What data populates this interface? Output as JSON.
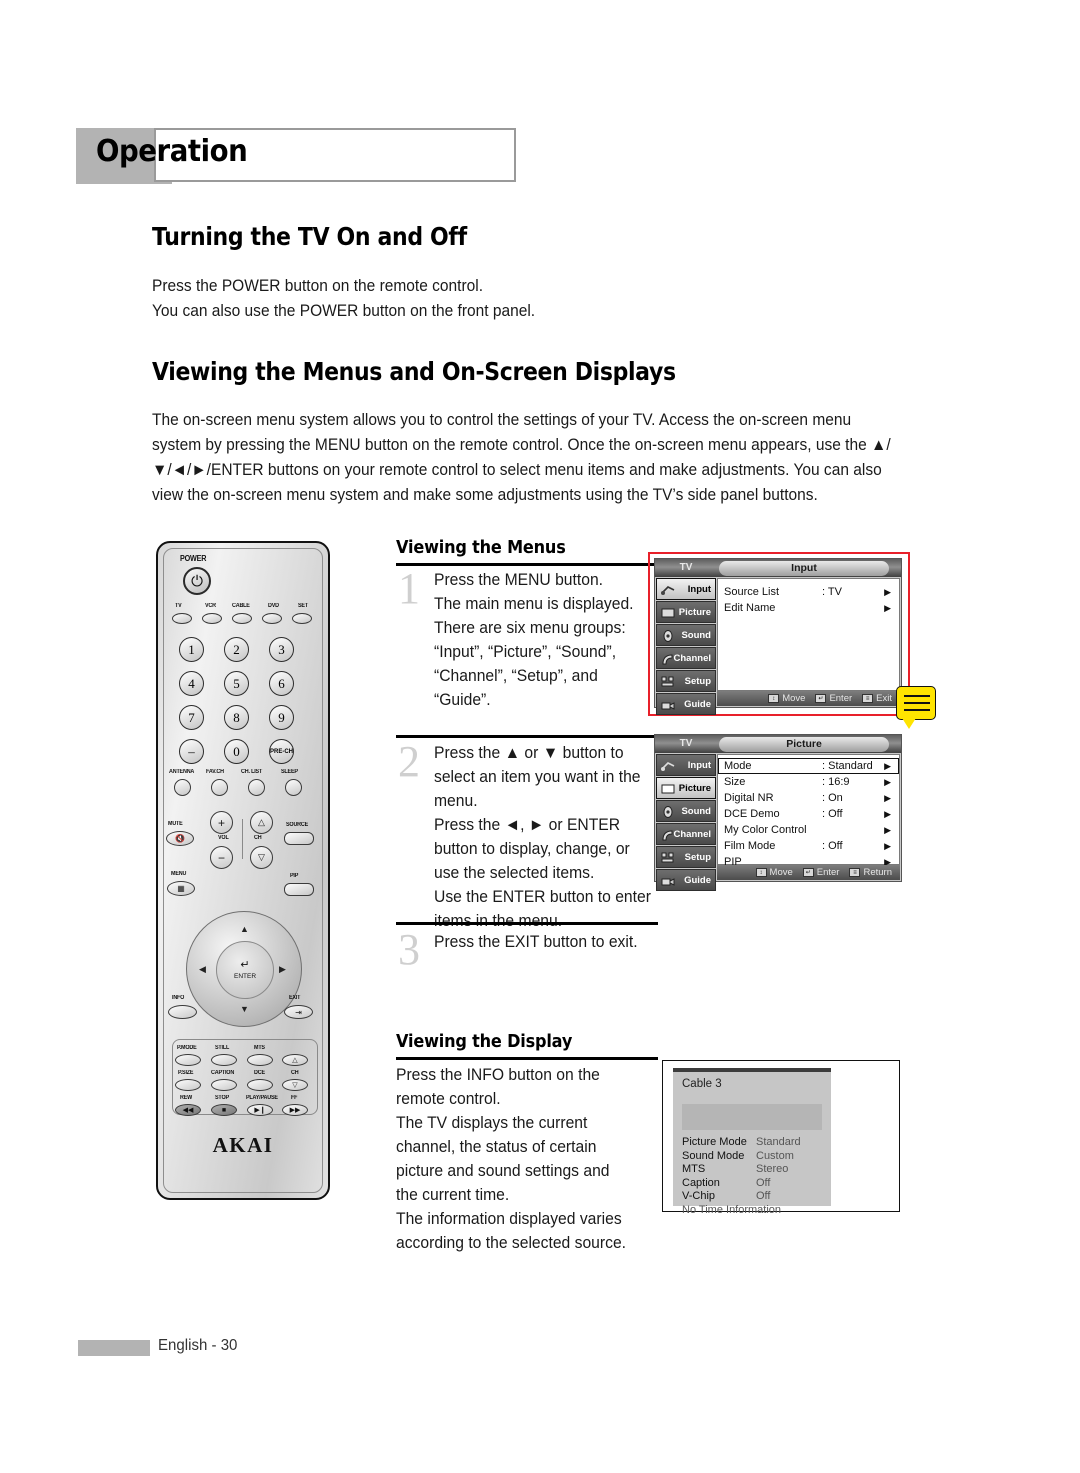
{
  "chapter": {
    "title": "Operation"
  },
  "sections": {
    "turning": {
      "heading": "Turning the TV On and Off",
      "paragraph": "Press the POWER button on the remote control.\nYou can also use the POWER button on the front panel."
    },
    "viewing": {
      "heading": "Viewing the Menus and On-Screen Displays",
      "paragraph": "The on-screen menu system allows you to control the settings of your TV. Access the on-screen menu system by pressing the MENU button on the remote control. Once the on-screen menu appears, use the ▲/▼/◄/►/ENTER buttons on your remote control to select menu items and make adjustments. You can also view the on-screen menu system and make some adjustments using the TV’s side panel buttons."
    },
    "menus_subhead": "Viewing the Menus",
    "display_subhead": "Viewing the Display",
    "display_paragraph": "Press the INFO button on the remote control.\nThe TV displays the current channel, the status of certain picture and sound settings and the current time.\nThe information displayed varies according to the selected source."
  },
  "steps": [
    {
      "number": "1",
      "text": "Press the MENU button.\nThe main menu is displayed.\nThere are six menu groups:\n“Input”, “Picture”, “Sound”,\n“Channel”, “Setup”, and\n“Guide”."
    },
    {
      "number": "2",
      "text": "Press the ▲ or ▼ button to select an item you want in the menu.\nPress the ◄, ► or ENTER button to display, change, or use the selected items.\nUse the ENTER button to enter items in the menu."
    },
    {
      "number": "3",
      "text": "Press the EXIT button to exit."
    }
  ],
  "remote": {
    "power_label": "POWER",
    "device_buttons": [
      "TV",
      "VCR",
      "CABLE",
      "DVD",
      "SET"
    ],
    "number_buttons": [
      "1",
      "2",
      "3",
      "4",
      "5",
      "6",
      "7",
      "8",
      "9",
      "–",
      "0",
      "PRE-CH"
    ],
    "channel_row": [
      "ANTENNA",
      "FAV.CH",
      "CH. LIST",
      "SLEEP"
    ],
    "mute_label": "MUTE",
    "vol_label": "VOL",
    "ch_label": "CH",
    "source_label": "SOURCE",
    "menu_label": "MENU",
    "pip_label": "PIP",
    "enter_label": "ENTER",
    "info_label": "INFO",
    "exit_label": "EXIT",
    "media_row1": [
      "P.MODE",
      "STILL",
      "MTS"
    ],
    "media_row2": [
      "P.SIZE",
      "CAPTION",
      "DCE"
    ],
    "media_row3": [
      "REW",
      "STOP",
      "PLAY/PAUSE",
      "FF"
    ],
    "ch2_label": "CH",
    "brand": "AKAI"
  },
  "osd_input": {
    "source_label": "TV",
    "title": "Input",
    "sidebar": [
      "Input",
      "Picture",
      "Sound",
      "Channel",
      "Setup",
      "Guide"
    ],
    "selected_sidebar": "Input",
    "rows": [
      {
        "label": "Source List",
        "value": ": TV",
        "arrow": "▶"
      },
      {
        "label": "Edit Name",
        "value": "",
        "arrow": "▶"
      }
    ],
    "footer": [
      {
        "icon": "↕",
        "label": "Move"
      },
      {
        "icon": "↵",
        "label": "Enter"
      },
      {
        "icon": "≡",
        "label": "Exit"
      }
    ]
  },
  "osd_picture": {
    "source_label": "TV",
    "title": "Picture",
    "sidebar": [
      "Input",
      "Picture",
      "Sound",
      "Channel",
      "Setup",
      "Guide"
    ],
    "selected_sidebar": "Picture",
    "rows": [
      {
        "label": "Mode",
        "value": ": Standard",
        "arrow": "▶",
        "highlighted": true
      },
      {
        "label": "Size",
        "value": ": 16:9",
        "arrow": "▶"
      },
      {
        "label": "Digital NR",
        "value": ": On",
        "arrow": "▶"
      },
      {
        "label": "DCE Demo",
        "value": ": Off",
        "arrow": "▶"
      },
      {
        "label": "My Color Control",
        "value": "",
        "arrow": "▶"
      },
      {
        "label": "Film Mode",
        "value": ": Off",
        "arrow": "▶"
      },
      {
        "label": "PIP",
        "value": "",
        "arrow": "▶"
      }
    ],
    "footer": [
      {
        "icon": "↕",
        "label": "Move"
      },
      {
        "icon": "↵",
        "label": "Enter"
      },
      {
        "icon": "≡",
        "label": "Return"
      }
    ]
  },
  "info_display": {
    "channel": "Cable 3",
    "rows": [
      {
        "key": "Picture Mode",
        "value": "Standard"
      },
      {
        "key": "Sound Mode",
        "value": "Custom"
      },
      {
        "key": "MTS",
        "value": "Stereo"
      },
      {
        "key": "Caption",
        "value": "Off"
      },
      {
        "key": "V-Chip",
        "value": "Off"
      }
    ],
    "time_text": "No Time Information"
  },
  "footer": {
    "page_label": "English - 30"
  },
  "colors": {
    "accent_red": "#e8202a",
    "callout_yellow": "#ffe400",
    "gray_block": "#b3b3b3"
  }
}
